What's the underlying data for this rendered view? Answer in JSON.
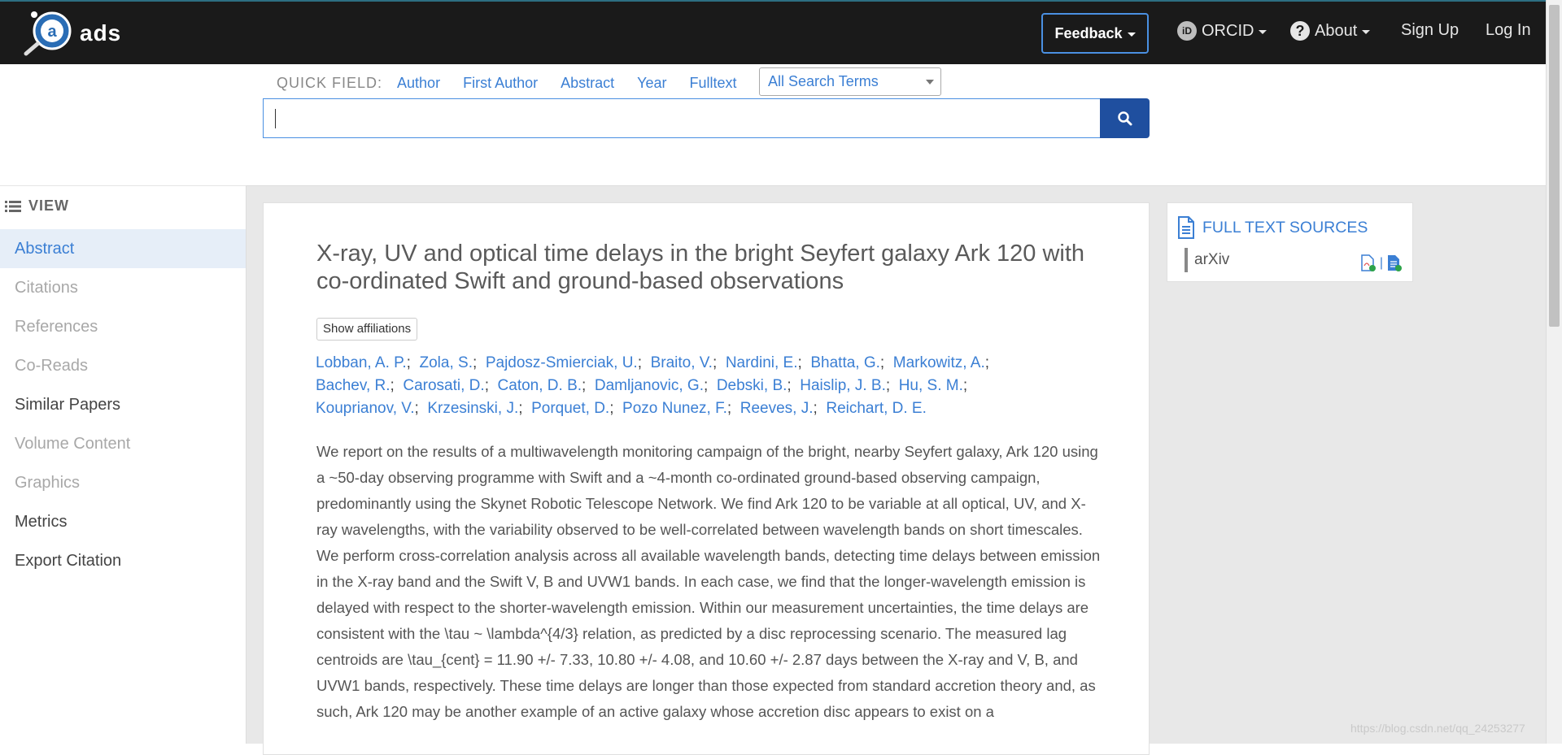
{
  "navbar": {
    "brand": "ads",
    "feedback_label": "Feedback",
    "orcid_label": "ORCID",
    "about_label": "About",
    "signup_label": "Sign Up",
    "login_label": "Log In"
  },
  "search": {
    "quick_field_label": "QUICK FIELD:",
    "quick_links": [
      "Author",
      "First Author",
      "Abstract",
      "Year",
      "Fulltext"
    ],
    "select_value": "All Search Terms",
    "input_value": ""
  },
  "sidebar": {
    "header": "VIEW",
    "items": [
      {
        "label": "Abstract",
        "state": "active"
      },
      {
        "label": "Citations",
        "state": "disabled"
      },
      {
        "label": "References",
        "state": "disabled"
      },
      {
        "label": "Co-Reads",
        "state": "disabled"
      },
      {
        "label": "Similar Papers",
        "state": "enabled"
      },
      {
        "label": "Volume Content",
        "state": "disabled"
      },
      {
        "label": "Graphics",
        "state": "disabled"
      },
      {
        "label": "Metrics",
        "state": "enabled"
      },
      {
        "label": "Export Citation",
        "state": "enabled"
      }
    ]
  },
  "paper": {
    "title": "X-ray, UV and optical time delays in the bright Seyfert galaxy Ark 120 with co-ordinated Swift and ground-based observations",
    "affiliations_button": "Show affiliations",
    "authors": [
      "Lobban, A. P.",
      "Zola, S.",
      "Pajdosz-Smierciak, U.",
      "Braito, V.",
      "Nardini, E.",
      "Bhatta, G.",
      "Markowitz, A.",
      "Bachev, R.",
      "Carosati, D.",
      "Caton, D. B.",
      "Damljanovic, G.",
      "Debski, B.",
      "Haislip, J. B.",
      "Hu, S. M.",
      "Kouprianov, V.",
      "Krzesinski, J.",
      "Porquet, D.",
      "Pozo Nunez, F.",
      "Reeves, J.",
      "Reichart, D. E."
    ],
    "abstract": "We report on the results of a multiwavelength monitoring campaign of the bright, nearby Seyfert galaxy, Ark 120 using a ~50-day observing programme with Swift and a ~4-month co-ordinated ground-based observing campaign, predominantly using the Skynet Robotic Telescope Network. We find Ark 120 to be variable at all optical, UV, and X-ray wavelengths, with the variability observed to be well-correlated between wavelength bands on short timescales. We perform cross-correlation analysis across all available wavelength bands, detecting time delays between emission in the X-ray band and the Swift V, B and UVW1 bands. In each case, we find that the longer-wavelength emission is delayed with respect to the shorter-wavelength emission. Within our measurement uncertainties, the time delays are consistent with the \\tau ~ \\lambda^{4/3} relation, as predicted by a disc reprocessing scenario. The measured lag centroids are \\tau_{cent} = 11.90 +/- 7.33, 10.80 +/- 4.08, and 10.60 +/- 2.87 days between the X-ray and V, B, and UVW1 bands, respectively. These time delays are longer than those expected from standard accretion theory and, as such, Ark 120 may be another example of an active galaxy whose accretion disc appears to exist on a"
  },
  "full_text": {
    "header": "FULL TEXT SOURCES",
    "source": "arXiv"
  },
  "watermark": "https://blog.csdn.net/qq_24253277",
  "colors": {
    "accent": "#3b7fd4",
    "navbar": "#1a1a1a",
    "search_button": "#1f4f9f"
  }
}
